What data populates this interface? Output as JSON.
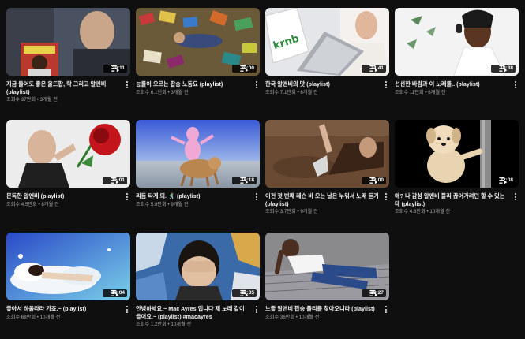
{
  "videos": [
    {
      "title": "지금 들어도 좋은 올드팝, 락 그리고 알앤비 (playlist)",
      "views": "조회수 37만회",
      "age": "3개월 전",
      "duration": "29:11",
      "thumbnail": "man-with-record-album"
    },
    {
      "title": "능률이 오르는 팝송 노동요 (playlist)",
      "views": "조회수 6.1천회",
      "age": "3개월 전",
      "duration": "30:00",
      "thumbnail": "man-in-pile-of-books"
    },
    {
      "title": "한국 알앤비의 맛 (playlist)",
      "views": "조회수 7.1만회",
      "age": "6개월 전",
      "duration": "24:41",
      "thumbnail": "laptop-krnb"
    },
    {
      "title": "선선한 바람과 이 노래를.. (playlist)",
      "views": "조회수 11만회",
      "age": "6개월 전",
      "duration": "19:38",
      "thumbnail": "woman-with-headphones"
    },
    {
      "title": "몬독한 알앤비 (playlist)",
      "views": "조회수 4.5만회",
      "age": "8개월 전",
      "duration": "15:01",
      "thumbnail": "man-with-rose"
    },
    {
      "title": "리듬 타게 되. 🕺 (playlist)",
      "views": "조회수 5.8만회",
      "age": "9개월 전",
      "duration": "16:18",
      "thumbnail": "pink-figure-on-dog"
    },
    {
      "title": "이건 첫 번째 레슨 비 오는 날은 누워서 노래 듣기 (playlist)",
      "views": "조회수 3.7만회",
      "age": "9개월 전",
      "duration": "18:00",
      "thumbnail": "woman-lying-in-dirt"
    },
    {
      "title": "애? 나 감성 알앤비 풀리 끊어가려던 할 수 있는데 (playlist)",
      "views": "조회수 4.8만회",
      "age": "10개월 전",
      "duration": "22:08",
      "thumbnail": "puppy-on-pole"
    },
    {
      "title": "좋아서 하울라라 가죠.~ (playlist)",
      "views": "조회수 68만회",
      "age": "10개월 전",
      "duration": "18:04",
      "thumbnail": "woman-on-cloud"
    },
    {
      "title": "안녕하세요.~ Mac Ayres 입니다 제 노래 같이 들어요.~ (playlist) #macayres",
      "views": "조회수 1.2만회",
      "age": "10개월 전",
      "duration": "22:35",
      "thumbnail": "man-covering-eyes"
    },
    {
      "title": "느좋 알앤비 팝송 플리를 찾아오니라 (playlist)",
      "views": "조회수 36만회",
      "age": "10개월 전",
      "duration": "29:27",
      "thumbnail": "man-lying-on-couch"
    }
  ],
  "colors": {
    "background": "#0f0f0f",
    "title": "#f1f1f1",
    "secondary": "#aaaaaa",
    "badge": "rgba(0,0,0,0.82)"
  }
}
